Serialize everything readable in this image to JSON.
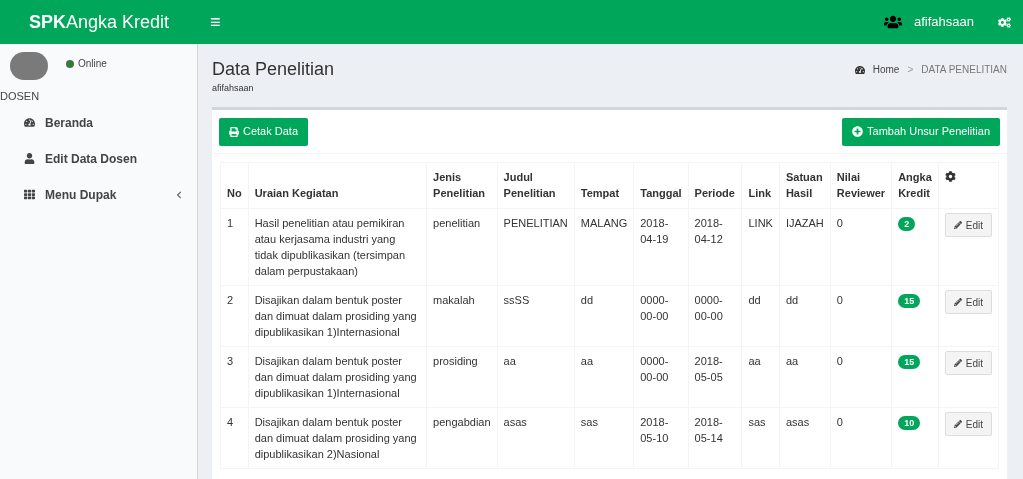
{
  "header": {
    "logo_bold": "SPK",
    "logo_rest": "Angka Kredit",
    "menu_toggle": "≡",
    "user": "afifahsaan"
  },
  "sidebar": {
    "status": "Online",
    "role": "DOSEN",
    "items": [
      {
        "label": "Beranda",
        "kind": "dashboard",
        "expandable": false
      },
      {
        "label": "Edit Data Dosen",
        "kind": "user",
        "expandable": false
      },
      {
        "label": "Menu Dupak",
        "kind": "grid",
        "expandable": true
      }
    ]
  },
  "page": {
    "title": "Data Penelitian",
    "subtitle": "afifahsaan",
    "breadcrumb": [
      "Home",
      "DATA PENELITIAN"
    ],
    "breadcrumb_separator": ">"
  },
  "buttons": {
    "print": "Cetak Data",
    "add": "Tambah Unsur Penelitian"
  },
  "table": {
    "columns": [
      "No",
      "Uraian Kegiatan",
      "Jenis Penelitian",
      "Judul Penelitian",
      "Tempat",
      "Tanggal",
      "Periode",
      "Link",
      "Satuan Hasil",
      "Nilai Reviewer",
      "Angka Kredit"
    ],
    "rows": [
      {
        "cells": [
          "1",
          "Hasil penelitian atau pemikiran atau kerjasama industri yang tidak dipublikasikan (tersimpan dalam perpustakaan)",
          "penelitian",
          "PENELITIAN",
          "MALANG",
          "2018-04-19",
          "2018-04-12",
          "LINK",
          "IJAZAH",
          "0"
        ],
        "credit": "2",
        "action": "Edit"
      },
      {
        "cells": [
          "2",
          "Disajikan dalam bentuk poster dan dimuat dalam prosiding yang dipublikasikan 1)Internasional",
          "makalah",
          "ssSS",
          "dd",
          "0000-00-00",
          "0000-00-00",
          "dd",
          "dd",
          "0"
        ],
        "credit": "15",
        "action": "Edit"
      },
      {
        "cells": [
          "3",
          "Disajikan dalam bentuk poster dan dimuat dalam prosiding yang dipublikasikan 1)Internasional",
          "prosiding",
          "aa",
          "aa",
          "0000-00-00",
          "2018-05-05",
          "aa",
          "aa",
          "0"
        ],
        "credit": "15",
        "action": "Edit"
      },
      {
        "cells": [
          "4",
          "Disajikan dalam bentuk poster dan dimuat dalam prosiding yang dipublikasikan 2)Nasional",
          "pengabdian",
          "asas",
          "sas",
          "2018-05-10",
          "2018-05-14",
          "sas",
          "asas",
          "0"
        ],
        "credit": "10",
        "action": "Edit"
      }
    ]
  }
}
